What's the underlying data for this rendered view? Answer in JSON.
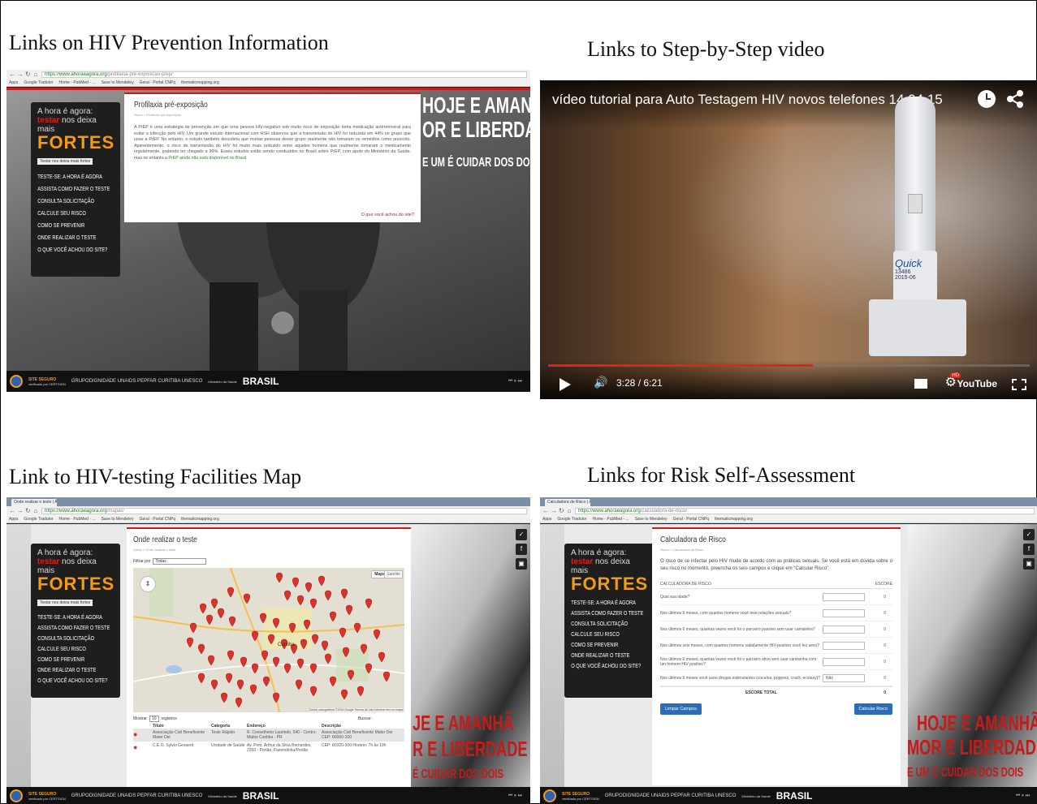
{
  "captions": {
    "prevention": "Links on HIV Prevention Information",
    "video": "Links to Step-by-Step video",
    "map": "Link to HIV-testing Facilities Map",
    "risk": "Links for Risk Self-Assessment"
  },
  "browser": {
    "apps": "Apps",
    "bookmarks": [
      "Google Tradutor",
      "Home - PubMed - ...",
      "Save to Mendeley",
      "Geral - Portal CNPq",
      "thematicmapping.org"
    ],
    "tabs": {
      "map": "Onde realizar o teste | A ×",
      "risk": "Calculadora de Risco | A ×"
    },
    "urls": {
      "prevention": {
        "host": "https://www.ahoraeagora.org",
        "path": "/profilaxia-pre-exposicao-prep/"
      },
      "map": {
        "host": "https://www.ahoraeagora.org",
        "path": "/mapas/"
      },
      "risk": {
        "host": "https://www.ahoraeagora.org",
        "path": "/calculadora-de-risco/"
      }
    }
  },
  "site": {
    "brand": {
      "line1": "A hora é agora:",
      "testar": "testar",
      "line2_rest": " nos deixa mais",
      "line3": "FORTES",
      "tooltip": "Testar nos deixa mais fortes"
    },
    "menu": [
      "TESTE-SE: A HORA É AGORA",
      "ASSISTA COMO FAZER O TESTE",
      "CONSULTA SOLICITAÇÃO",
      "CALCULE SEU RISCO",
      "COMO SE PREVENIR",
      "ONDE REALIZAR O TESTE",
      "O QUE VOCÊ ACHOU DO SITE?"
    ],
    "slogan": {
      "a": "HOJE E AMANHÃ,",
      "b": "OR E LIBERDADE.",
      "c": "E UM É CUIDAR DOS DOIS"
    },
    "slogan_red": {
      "a": "JE E AMANHÃ",
      "b": "R E LIBERDADE",
      "c": "É CUIDAR DOS DOIS",
      "d": "HOJE E AMANHÃ",
      "e": "MOR E LIBERDADE",
      "f": "E UM É CUIDAR DOS DOIS"
    },
    "footer": {
      "site_seguro": "SITE SEGURO",
      "verificado": "verificado por CERTSIGN",
      "partners": "GRUPODIGNIDADE  UNAIDS  PEPFAR  CURITIBA  UNESCO",
      "ministerio": "Ministério da Saúde",
      "brasil": "BRASIL",
      "controls": "⏮ ⏸ ⏭"
    }
  },
  "prep_page": {
    "title": "Profilaxia pré-exposição",
    "crumb": "Home > Profilaxia pré-exposição",
    "body": "A PrEP é uma estratégia de prevenção em que uma pessoa HIV-negativo sob muito risco de exposição toma medicação antirretroviral para evitar a infecção pelo HIV. Um grande estudo internacional com HSH observou que a transmissão do HIV foi reduzida em 44% no grupo que usou a PrEP. No entanto, o estudo também descobriu que muitas pessoas desse grupo realmente não tomaram os remédios como prescrito. Aparentemente, o risco de transmissão do HIV foi muito mais reduzido entre aqueles homens que realmente tomaram o medicamento regularmente, podendo ter chegado a 90%. Esses estudos estão sendo conduzidos no Brasil sobre PrEP, com apoio do Ministério da Saúde, mas no entanto a ",
    "body_link": "PrEP ainda não está disponível no Brasil.",
    "feedback": "O que você achou do site?"
  },
  "video": {
    "title": "vídeo tutorial para Auto Testagem HIV novos telefones 14 04 15",
    "time": "3:28 / 6:21",
    "progress": 0.55,
    "hd": "HD",
    "youtube": "YouTube",
    "device_label": "Quick",
    "device_lines": [
      "13486",
      "2015-06"
    ]
  },
  "map_page": {
    "title": "Onde realizar o teste",
    "crumb": "Home > Onde realizar o teste",
    "filter_label": "Filtrar por",
    "filter_value": "Todas",
    "map_btn": "Mapa",
    "sat_btn": "Satélite",
    "city": "Curitiba",
    "attribution": "Dados cartográficos ©2015 Google   Termos de Uso   Informar erro no mapa",
    "show_label": "Mostrar",
    "show_value": "10",
    "records": "registros",
    "search_label": "Buscar:",
    "columns": [
      "Título",
      "Categoria",
      "Endereço",
      "Descrição"
    ],
    "rows": [
      [
        "Associação Civil Beneficente Mater Dei",
        "Teste Rápido",
        "R. Conselheiro Laurindo, 540 - Centro, Matriz Curitiba - PR",
        "Associação Civil Beneficente Mater Dei CEP: 80060-100"
      ],
      [
        "C.E.O. Sylvio Gevaerd",
        "Unidade de Saúde",
        "Av. Pres. Arthur da Silva Bernardes, 2350 - Portão, Fazendinha/Portão",
        "CEP: 80320-300 Horário: 7h às 19h"
      ]
    ]
  },
  "risk_page": {
    "title": "Calculadora de Risco",
    "crumb": "Home > Calculadora de Risco",
    "intro": "O risco de se infectar pelo HIV muda de acordo com as práticas sexuais. Se você está em dúvida sobre o seu risco no momento, preencha os seis campos e clique em “Calcular Risco”.",
    "table_header": "CALCULADORA DE RISCO",
    "score_header": "ESCORE",
    "questions": [
      {
        "q": "Qual sua idade?",
        "score": "0"
      },
      {
        "q": "Nos últimos 6 meses, com quantos homens você teve relações sexuais?",
        "score": "0"
      },
      {
        "q": "Nos últimos 6 meses, quantas vezes você foi o parceiro passivo sem usar camisinha?",
        "score": "0"
      },
      {
        "q": "Nos últimos seis meses, com quantos homens sabidamente HIV-positivo você fez sexo?",
        "score": "0"
      },
      {
        "q": "Nos últimos 6 meses, quantas vezes você foi o parceiro ativo sem usar camisinha com um homem HIV positivo?",
        "score": "0"
      },
      {
        "q": "Nos últimos 6 meses você usou drogas estimulantes (cocaína, poppers, crack, ecstasy)?",
        "score": "0",
        "select": "Não"
      }
    ],
    "total_label": "ESCORE TOTAL",
    "total": "0",
    "clear_btn": "Limpar Campos",
    "calc_btn": "Calcular Risco"
  },
  "colors": {
    "accent_red": "#c41b1b",
    "brand_orange": "#f39c12",
    "video_red": "#e62117",
    "link_blue": "#2a6ebb",
    "pin_red": "#d9332b"
  }
}
